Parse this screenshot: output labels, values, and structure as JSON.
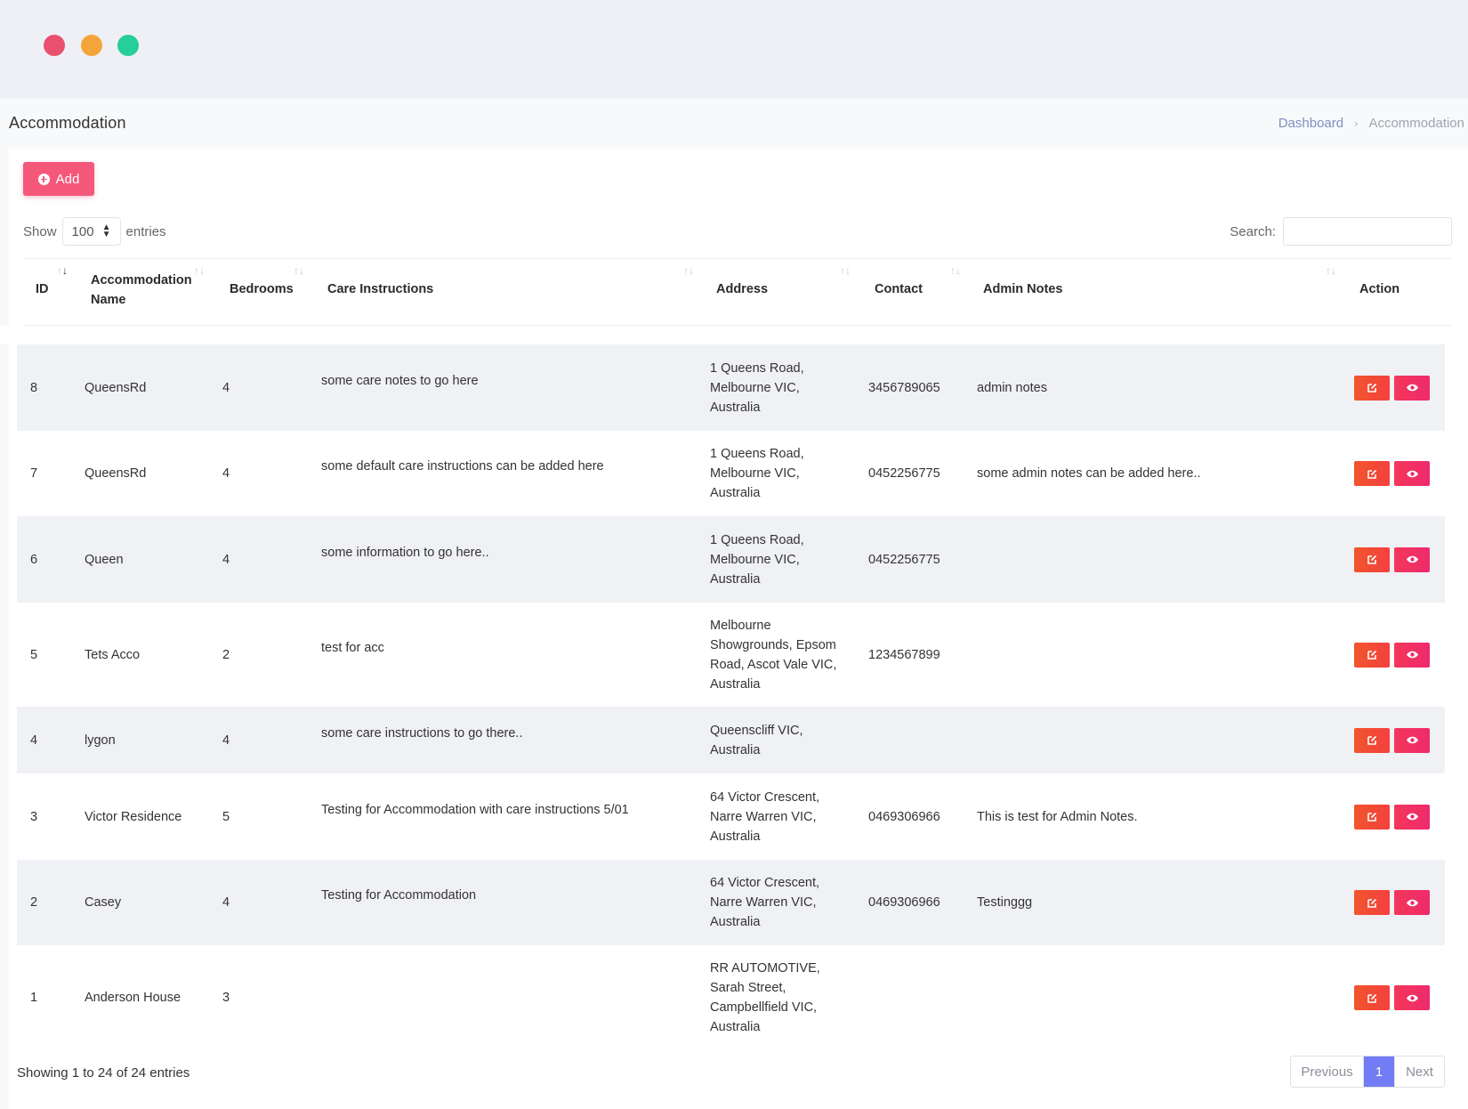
{
  "page": {
    "title": "Accommodation"
  },
  "breadcrumb": {
    "home": "Dashboard",
    "separator": "›",
    "current": "Accommodation"
  },
  "toolbar": {
    "add_label": "Add",
    "add_icon": "plus-circle-icon"
  },
  "table_controls": {
    "show_label": "Show",
    "page_size": "100",
    "entries_label": "entries",
    "search_label": "Search:",
    "search_value": ""
  },
  "columns": [
    "ID",
    "Accommodation Name",
    "Bedrooms",
    "Care Instructions",
    "Address",
    "Contact",
    "Admin Notes",
    "Action"
  ],
  "rows": [
    {
      "id": "8",
      "name": "QueensRd",
      "bedrooms": "4",
      "care": "some care notes to go here",
      "address": [
        "1 Queens Road,",
        "Melbourne VIC,",
        "Australia"
      ],
      "contact": "3456789065",
      "notes": "admin notes"
    },
    {
      "id": "7",
      "name": "QueensRd",
      "bedrooms": "4",
      "care": "some default care instructions can be added here",
      "address": [
        "1 Queens Road,",
        "Melbourne VIC,",
        "Australia"
      ],
      "contact": "0452256775",
      "notes": "some admin notes can be added here.."
    },
    {
      "id": "6",
      "name": "Queen",
      "bedrooms": "4",
      "care": "some information to go here..",
      "address": [
        "1 Queens Road,",
        "Melbourne VIC,",
        "Australia"
      ],
      "contact": "0452256775",
      "notes": ""
    },
    {
      "id": "5",
      "name": "Tets Acco",
      "bedrooms": "2",
      "care": "test for acc",
      "address": [
        "Melbourne",
        "Showgrounds, Epsom",
        "Road, Ascot Vale VIC,",
        "Australia"
      ],
      "contact": "1234567899",
      "notes": ""
    },
    {
      "id": "4",
      "name": "lygon",
      "bedrooms": "4",
      "care": "some care instructions to go there..",
      "address": [
        "Queenscliff VIC,",
        "Australia"
      ],
      "contact": "",
      "notes": ""
    },
    {
      "id": "3",
      "name": "Victor Residence",
      "bedrooms": "5",
      "care": "Testing for Accommodation with care instructions 5/01",
      "address": [
        "64 Victor Crescent,",
        "Narre Warren VIC,",
        "Australia"
      ],
      "contact": "0469306966",
      "notes": "This is test for Admin Notes."
    },
    {
      "id": "2",
      "name": "Casey",
      "bedrooms": "4",
      "care": "Testing for Accommodation",
      "address": [
        "64 Victor Crescent,",
        "Narre Warren VIC,",
        "Australia"
      ],
      "contact": "0469306966",
      "notes": "Testinggg"
    },
    {
      "id": "1",
      "name": "Anderson House",
      "bedrooms": "3",
      "care": "",
      "address": [
        "RR AUTOMOTIVE,",
        "Sarah Street,",
        "Campbellfield VIC,",
        "Australia"
      ],
      "contact": "",
      "notes": ""
    }
  ],
  "action_icons": {
    "edit": "edit-icon",
    "view": "eye-icon"
  },
  "footer": {
    "info": "Showing 1 to 24 of 24 entries",
    "previous": "Previous",
    "current_page": "1",
    "next": "Next"
  },
  "colors": {
    "accent": "#f5577b",
    "edit": "#f1562c",
    "view": "#ef2a6c",
    "pager_active": "#727cf5",
    "row_shade": "#f0f1f5"
  }
}
